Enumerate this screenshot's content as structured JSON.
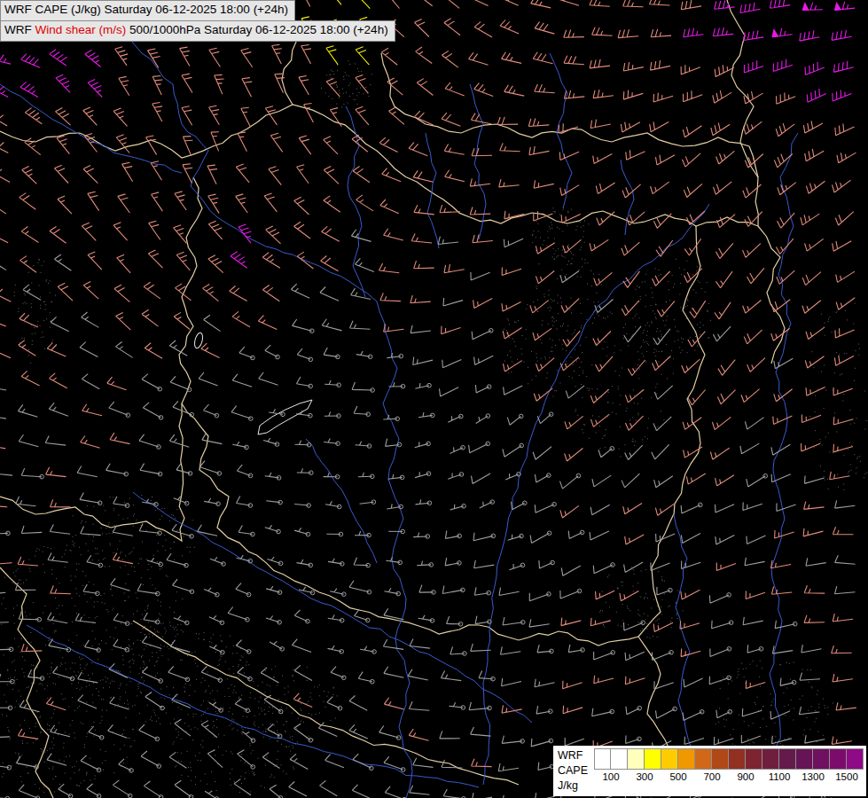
{
  "header": {
    "line1": "WRF CAPE (J/kg) Saturday 06-12-2025 18:00 (+24h)",
    "line2_prefix": "WRF ",
    "line2_param": "Wind shear (m/s)",
    "line2_suffix": " 500/1000hPa Saturday 06-12-2025 18:00 (+24h)",
    "text_color": "#000000",
    "highlight_color": "#dd0000",
    "box_bg": "#e6e6e6"
  },
  "legend": {
    "title_lines": [
      "WRF",
      "CAPE",
      "J/kg"
    ],
    "tick_labels": [
      "100",
      "300",
      "500",
      "700",
      "900",
      "1100",
      "1300",
      "1500"
    ],
    "swatch_colors": [
      "#ffffff",
      "#ffffff",
      "#ffffbb",
      "#ffff00",
      "#ffcc00",
      "#f09800",
      "#d06818",
      "#b04818",
      "#923022",
      "#7e2430",
      "#701e3e",
      "#641a4a",
      "#661456",
      "#701060",
      "#7c0c6c",
      "#8e0a86"
    ]
  },
  "map": {
    "background": "#000000",
    "border_color": "#efd9ac",
    "river_color": "#3a5bd0",
    "lake_outline_color": "#e8e8e8",
    "stipple_color": "#7f7f7f",
    "barb_colors": {
      "weak": "#9e9e9e",
      "moderate": "#e28b7b",
      "strong": "#e61ae6",
      "special": "#f2f200"
    }
  }
}
